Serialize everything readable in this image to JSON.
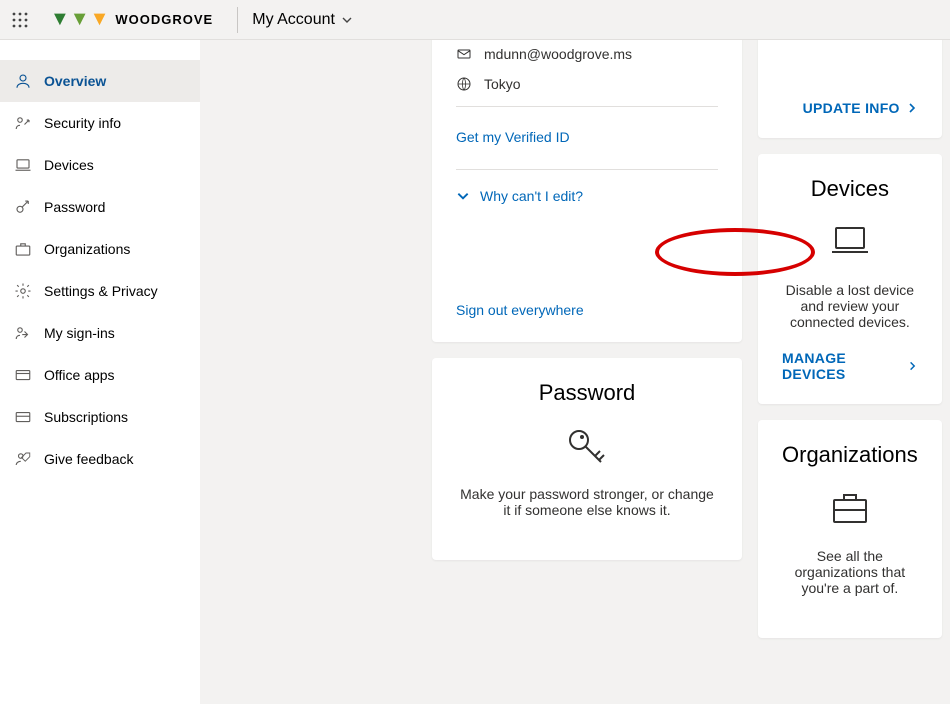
{
  "header": {
    "brand": "WOODGROVE",
    "title": "My Account"
  },
  "sidebar": {
    "items": [
      {
        "label": "Overview",
        "icon": "person",
        "active": true
      },
      {
        "label": "Security info",
        "icon": "key-person",
        "active": false
      },
      {
        "label": "Devices",
        "icon": "laptop",
        "active": false
      },
      {
        "label": "Password",
        "icon": "key",
        "active": false
      },
      {
        "label": "Organizations",
        "icon": "briefcase",
        "active": false
      },
      {
        "label": "Settings & Privacy",
        "icon": "gear",
        "active": false
      },
      {
        "label": "My sign-ins",
        "icon": "signin",
        "active": false
      },
      {
        "label": "Office apps",
        "icon": "apps",
        "active": false
      },
      {
        "label": "Subscriptions",
        "icon": "card",
        "active": false
      },
      {
        "label": "Give feedback",
        "icon": "feedback",
        "active": false
      }
    ]
  },
  "profile_card": {
    "email": "mdunn@woodgrove.ms",
    "location": "Tokyo",
    "verified_link": "Get my Verified ID",
    "why_edit": "Why can't I edit?",
    "signout": "Sign out everywhere"
  },
  "right_top_card": {
    "action": "UPDATE INFO"
  },
  "devices_card": {
    "title": "Devices",
    "desc": "Disable a lost device and review your connected devices.",
    "action": "MANAGE DEVICES"
  },
  "password_card": {
    "title": "Password",
    "desc": "Make your password stronger, or change it if someone else knows it."
  },
  "org_card": {
    "title": "Organizations",
    "desc": "See all the organizations that you're a part of."
  }
}
